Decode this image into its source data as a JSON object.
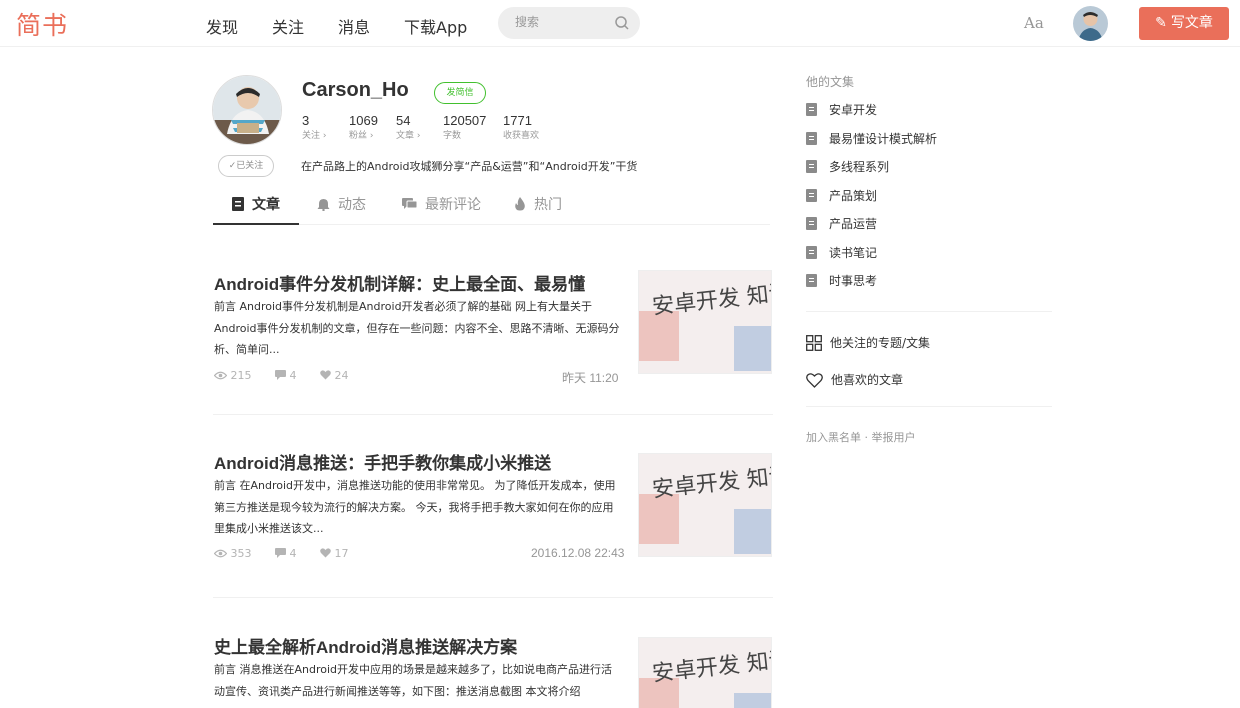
{
  "nav": {
    "logo": "简书",
    "menu": [
      "发现",
      "关注",
      "消息",
      "下载App"
    ],
    "search_placeholder": "搜索",
    "font_toggle": "Aa",
    "write_label": "写文章",
    "brand_color": "#ea6f5a"
  },
  "profile": {
    "username": "Carson_Ho",
    "message_button": "发简信",
    "follow_button": "✓已关注",
    "intro": "在产品路上的Android攻城狮分享“产品&运营”和“Android开发”干货",
    "stats": [
      {
        "num": "3",
        "label": "关注 ›"
      },
      {
        "num": "1069",
        "label": "粉丝 ›"
      },
      {
        "num": "54",
        "label": "文章 ›"
      },
      {
        "num": "120507",
        "label": "字数"
      },
      {
        "num": "1771",
        "label": "收获喜欢"
      }
    ]
  },
  "tabs": [
    {
      "label": "文章",
      "icon": "document-icon"
    },
    {
      "label": "动态",
      "icon": "bell-icon"
    },
    {
      "label": "最新评论",
      "icon": "comment-icon"
    },
    {
      "label": "热门",
      "icon": "fire-icon"
    }
  ],
  "articles": [
    {
      "title": "Android事件分发机制详解：史上最全面、最易懂",
      "abstract": "前言 Android事件分发机制是Android开发者必须了解的基础 网上有大量关于Android事件分发机制的文章，但存在一些问题：内容不全、思路不清晰、无源码分析、简单问...",
      "views": "215",
      "comments": "4",
      "likes": "24",
      "time": "昨天 11:20",
      "thumb_text": "安卓开发 知识总结"
    },
    {
      "title": "Android消息推送：手把手教你集成小米推送",
      "abstract": "前言 在Android开发中，消息推送功能的使用非常常见。 为了降低开发成本，使用第三方推送是现今较为流行的解决方案。 今天，我将手把手教大家如何在你的应用里集成小米推送该文...",
      "views": "353",
      "comments": "4",
      "likes": "17",
      "time": "2016.12.08 22:43",
      "thumb_text": "安卓开发 知识总结"
    },
    {
      "title": "史上最全解析Android消息推送解决方案",
      "abstract": "前言 消息推送在Android开发中应用的场景是越来越多了，比如说电商产品进行活动宣传、资讯类产品进行新闻推送等等，如下图：推送消息截图 本文将介绍",
      "thumb_text": "安卓开发 知识总结"
    }
  ],
  "sidebar": {
    "heading": "他的文集",
    "collections": [
      "安卓开发",
      "最易懂设计模式解析",
      "多线程系列",
      "产品策划",
      "产品运营",
      "读书笔记",
      "时事思考"
    ],
    "followed_topics": "他关注的专题/文集",
    "liked_articles": "他喜欢的文章",
    "footer": "加入黑名单 · 举报用户"
  }
}
